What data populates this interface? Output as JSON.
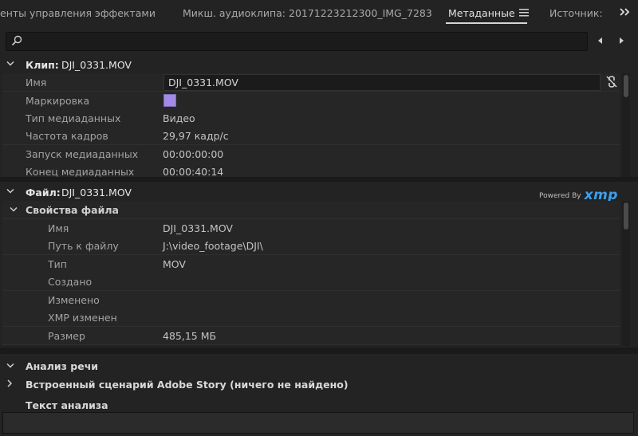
{
  "tabs": [
    {
      "label": "енты управления эффектами"
    },
    {
      "label": "Микш. аудиоклипа: 20171223212300_IMG_7283"
    },
    {
      "label": "Метаданные"
    },
    {
      "label": "Источник:"
    }
  ],
  "search": {
    "placeholder": "",
    "value": ""
  },
  "clip": {
    "title": "Клип:",
    "name": "DJI_0331.MOV",
    "rows": [
      {
        "label": "Имя",
        "value": "DJI_0331.MOV"
      },
      {
        "label": "Маркировка",
        "value": ""
      },
      {
        "label": "Тип медиаданных",
        "value": "Видео"
      },
      {
        "label": "Частота кадров",
        "value": "29,97 кадр/с"
      },
      {
        "label": "Запуск медиаданных",
        "value": "00:00:00:00"
      },
      {
        "label": "Конец медиаданных",
        "value": "00:00:40:14"
      }
    ],
    "label_color": "#a28ae6"
  },
  "file": {
    "title": "Файл:",
    "name": "DJI_0331.MOV",
    "powered_by": "Powered By",
    "xmp": "xmp",
    "properties_title": "Свойства файла",
    "rows": [
      {
        "label": "Имя",
        "value": "DJI_0331.MOV"
      },
      {
        "label": "Путь к файлу",
        "value": "J:\\video_footage\\DJI\\"
      },
      {
        "label": "Тип",
        "value": "MOV"
      },
      {
        "label": "Создано",
        "value": ""
      },
      {
        "label": "Изменено",
        "value": ""
      },
      {
        "label": "XMP изменен",
        "value": ""
      },
      {
        "label": "Размер",
        "value": "485,15 МБ"
      }
    ]
  },
  "speech": {
    "title": "Анализ речи",
    "embedded_script": "Встроенный сценарий Adobe Story (ничего не найдено)",
    "analysis_text": "Текст анализа"
  },
  "colors": {
    "accent": "#3da0f0",
    "background": "#232323"
  },
  "icons": [
    "search-icon",
    "menu-icon",
    "overflow-icon",
    "prev-icon",
    "next-icon",
    "unlink-icon",
    "chevron-down-icon",
    "chevron-right-icon"
  ]
}
